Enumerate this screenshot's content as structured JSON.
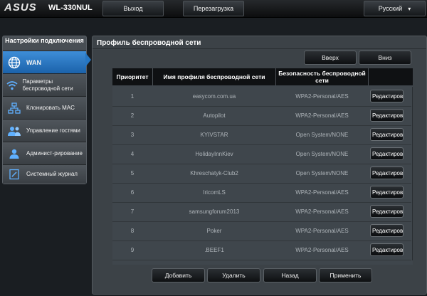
{
  "header": {
    "logo": "ASUS",
    "model": "WL-330NUL",
    "logout": "Выход",
    "reboot": "Перезагрузка",
    "language": "Русский"
  },
  "sidebar": {
    "heading": "Настройки подключения",
    "items": [
      {
        "label": "WAN",
        "icon": "globe-icon",
        "active": true
      },
      {
        "label": "Параметры беспроводной сети",
        "icon": "wifi-icon",
        "active": false
      },
      {
        "label": "Клонировать MAC",
        "icon": "network-icon",
        "active": false
      },
      {
        "label": "Управление гостями",
        "icon": "guests-icon",
        "active": false
      },
      {
        "label": "Админист-рирование",
        "icon": "admin-user-icon",
        "active": false
      },
      {
        "label": "Системный журнал",
        "icon": "log-icon",
        "active": false
      }
    ]
  },
  "main": {
    "title": "Профиль беспроводной сети",
    "up_label": "Вверх",
    "down_label": "Вниз",
    "columns": [
      "Приоритет",
      "Имя профиля беспроводной сети",
      "Безопасность беспроводной сети",
      ""
    ],
    "edit_label": "Редактиров",
    "rows": [
      {
        "priority": "1",
        "name": "easycom.com.ua",
        "security": "WPA2-Personal/AES"
      },
      {
        "priority": "2",
        "name": "Autopilot",
        "security": "WPA2-Personal/AES"
      },
      {
        "priority": "3",
        "name": "KYIVSTAR",
        "security": "Open System/NONE"
      },
      {
        "priority": "4",
        "name": "HolidayInnKiev",
        "security": "Open System/NONE"
      },
      {
        "priority": "5",
        "name": "Khreschatyk-Club2",
        "security": "Open System/NONE"
      },
      {
        "priority": "6",
        "name": "IricomLS",
        "security": "WPA2-Personal/AES"
      },
      {
        "priority": "7",
        "name": "samsungforum2013",
        "security": "WPA2-Personal/AES"
      },
      {
        "priority": "8",
        "name": "Poker",
        "security": "WPA2-Personal/AES"
      },
      {
        "priority": "9",
        "name": ".BEEF1",
        "security": "WPA2-Personal/AES"
      }
    ],
    "add_label": "Добавить",
    "delete_label": "Удалить",
    "back_label": "Назад",
    "apply_label": "Применить"
  },
  "colors": {
    "accent": "#1f6fbf",
    "background": "#1a1e22",
    "panel": "#3c4247"
  }
}
